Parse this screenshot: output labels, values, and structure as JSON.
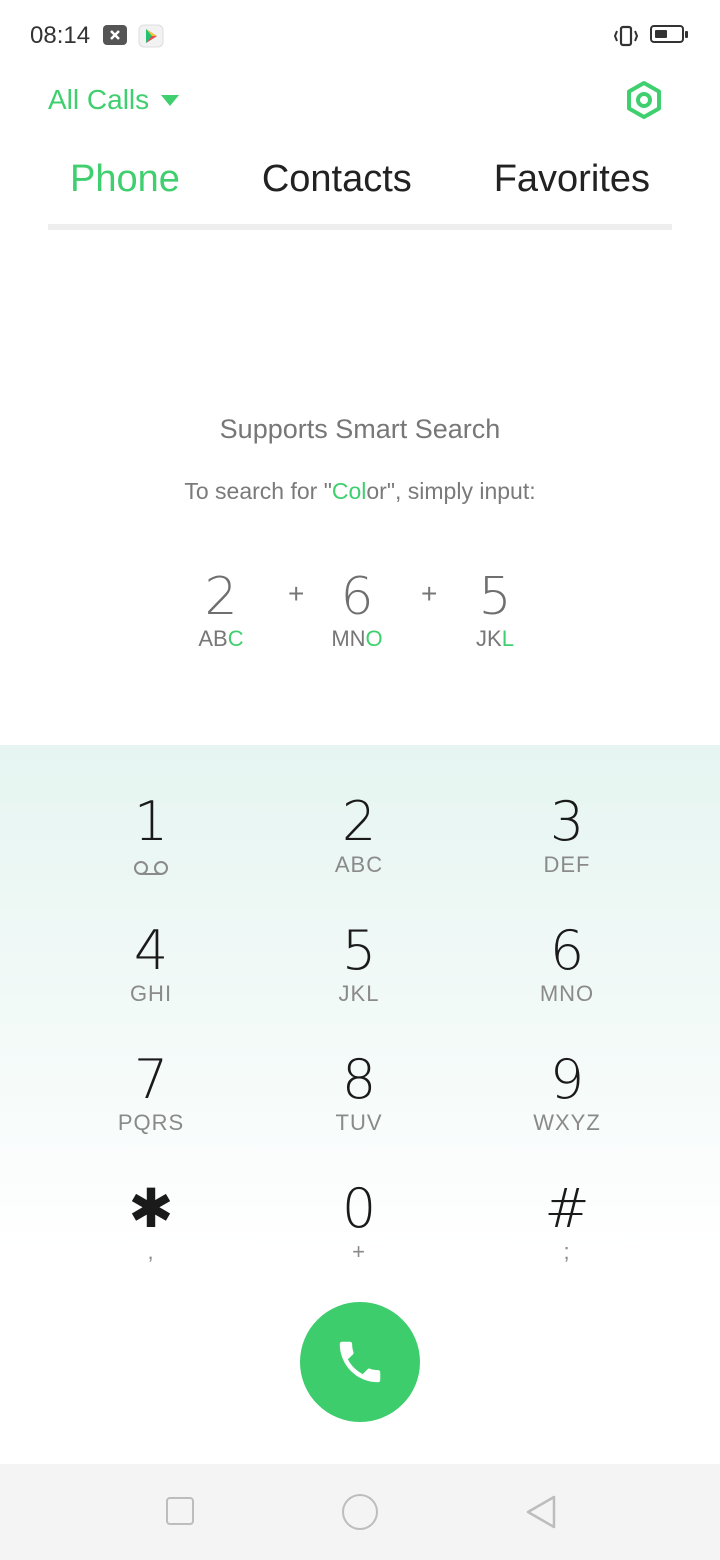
{
  "status_bar": {
    "time": "08:14"
  },
  "header": {
    "filter_label": "All Calls"
  },
  "tabs": [
    {
      "label": "Phone",
      "active": true
    },
    {
      "label": "Contacts",
      "active": false
    },
    {
      "label": "Favorites",
      "active": false
    }
  ],
  "smart_search": {
    "title": "Supports Smart Search",
    "subtitle_before": "To search for \"",
    "subtitle_highlight": "Col",
    "subtitle_after": "or\", simply input:",
    "example": [
      {
        "digit": "2",
        "letters_plain": "AB",
        "letters_highlight": "C"
      },
      {
        "digit": "6",
        "letters_plain": "MN",
        "letters_highlight": "O"
      },
      {
        "digit": "5",
        "letters_plain": "JK",
        "letters_highlight": "L"
      }
    ],
    "plus": "+"
  },
  "keypad": [
    {
      "number": "1",
      "sub": ""
    },
    {
      "number": "2",
      "sub": "ABC"
    },
    {
      "number": "3",
      "sub": "DEF"
    },
    {
      "number": "4",
      "sub": "GHI"
    },
    {
      "number": "5",
      "sub": "JKL"
    },
    {
      "number": "6",
      "sub": "MNO"
    },
    {
      "number": "7",
      "sub": "PQRS"
    },
    {
      "number": "8",
      "sub": "TUV"
    },
    {
      "number": "9",
      "sub": "WXYZ"
    },
    {
      "number": "✱",
      "sub": ","
    },
    {
      "number": "0",
      "sub": "+"
    },
    {
      "number": "#",
      "sub": ";"
    }
  ],
  "colors": {
    "accent": "#3fcf6f",
    "call_button": "#3ecd6c"
  },
  "icons": {
    "call": "phone-icon",
    "settings": "settings-icon",
    "voicemail": "voicemail-icon"
  }
}
